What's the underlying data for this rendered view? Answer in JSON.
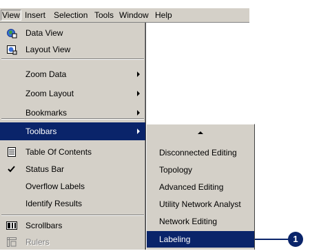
{
  "menubar": {
    "items": [
      "View",
      "Insert",
      "Selection",
      "Tools",
      "Window",
      "Help"
    ]
  },
  "view_menu": {
    "items": [
      {
        "label": "Data View",
        "icon": "globe-map-icon"
      },
      {
        "label": "Layout View",
        "icon": "layout-page-icon"
      },
      {
        "label": "Zoom Data",
        "submenu": true
      },
      {
        "label": "Zoom Layout",
        "submenu": true
      },
      {
        "label": "Bookmarks",
        "submenu": true
      },
      {
        "label": "Toolbars",
        "submenu": true,
        "selected": true
      },
      {
        "label": "Table Of Contents",
        "icon": "table-of-contents-icon"
      },
      {
        "label": "Status Bar",
        "checked": true
      },
      {
        "label": "Overflow Labels"
      },
      {
        "label": "Identify Results"
      },
      {
        "label": "Scrollbars",
        "icon": "scrollbars-icon"
      },
      {
        "label": "Rulers",
        "icon": "rulers-icon",
        "disabled": true
      }
    ]
  },
  "toolbars_submenu": {
    "items": [
      {
        "label": "Disconnected Editing"
      },
      {
        "label": "Topology"
      },
      {
        "label": "Advanced Editing"
      },
      {
        "label": "Utility Network Analyst"
      },
      {
        "label": "Network Editing"
      },
      {
        "label": "Labeling",
        "selected": true
      }
    ]
  },
  "callout": {
    "number": "1"
  },
  "colors": {
    "highlight": "#0a246a",
    "menu_bg": "#d4d0c8"
  }
}
